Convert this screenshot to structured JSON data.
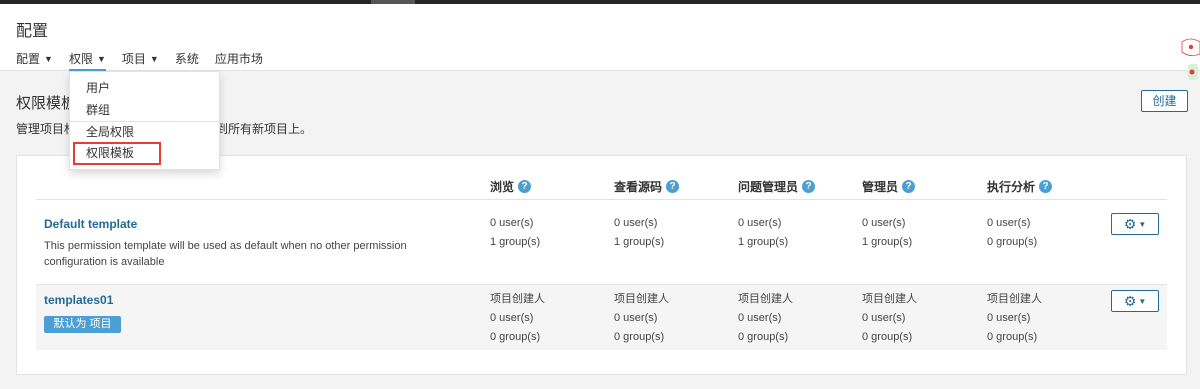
{
  "header": {
    "title": "配置",
    "nav": [
      {
        "label": "配置",
        "caret": true
      },
      {
        "label": "权限",
        "caret": true
      },
      {
        "label": "项目",
        "caret": true
      },
      {
        "label": "系统",
        "caret": false
      },
      {
        "label": "应用市场",
        "caret": false
      }
    ]
  },
  "dropdown": {
    "items": [
      "用户",
      "群组",
      "全局权限",
      "权限模板"
    ]
  },
  "section": {
    "title": "权限模板",
    "title_visible": "权限模板",
    "desc_left": "管理项目权",
    "desc_right": "到所有新项目上。",
    "create_label": "创建"
  },
  "columns": [
    "浏览",
    "查看源码",
    "问题管理员",
    "管理员",
    "执行分析"
  ],
  "templates": [
    {
      "name": "Default template",
      "description": "This permission template will be used as default when no other permission configuration is available",
      "badge": "",
      "cells": [
        [
          "0 user(s)",
          "1 group(s)"
        ],
        [
          "0 user(s)",
          "1 group(s)"
        ],
        [
          "0 user(s)",
          "1 group(s)"
        ],
        [
          "0 user(s)",
          "1 group(s)"
        ],
        [
          "0 user(s)",
          "0 group(s)"
        ]
      ]
    },
    {
      "name": "templates01",
      "description": "",
      "badge": "默认为 项目",
      "cells": [
        [
          "项目创建人",
          "0 user(s)",
          "0 group(s)"
        ],
        [
          "项目创建人",
          "0 user(s)",
          "0 group(s)"
        ],
        [
          "项目创建人",
          "0 user(s)",
          "0 group(s)"
        ],
        [
          "项目创建人",
          "0 user(s)",
          "0 group(s)"
        ],
        [
          "项目创建人",
          "0 user(s)",
          "0 group(s)"
        ]
      ]
    }
  ],
  "icons": {
    "help": "question-circle-icon",
    "gear": "gear-icon"
  },
  "colors": {
    "accent": "#4b9fd5",
    "link": "#236a97",
    "highlight_box": "#e53c3c"
  }
}
